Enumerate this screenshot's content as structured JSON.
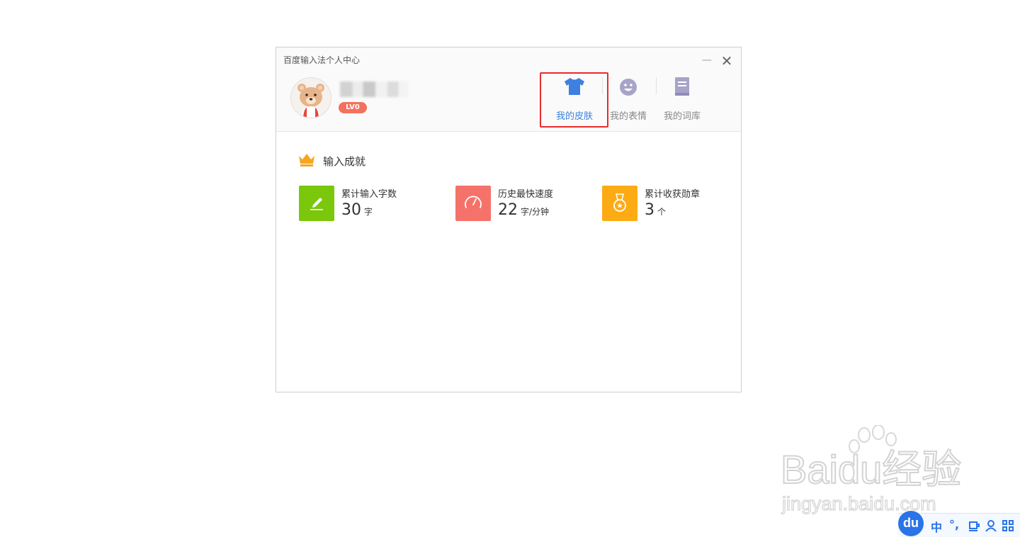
{
  "window": {
    "title": "百度输入法个人中心",
    "minimize_glyph": "—",
    "close_glyph": "✕"
  },
  "profile": {
    "level": "LV0"
  },
  "nav": [
    {
      "label": "我的皮肤",
      "icon": "tshirt-icon",
      "active": true
    },
    {
      "label": "我的表情",
      "icon": "smiley-icon",
      "active": false
    },
    {
      "label": "我的词库",
      "icon": "book-icon",
      "active": false
    }
  ],
  "achievements": {
    "title": "输入成就",
    "stats": [
      {
        "name": "累计输入字数",
        "value": "30",
        "unit": "字",
        "color": "#7ac70c",
        "icon": "pencil-icon"
      },
      {
        "name": "历史最快速度",
        "value": "22",
        "unit": "字/分钟",
        "color": "#f5726a",
        "icon": "speedometer-icon"
      },
      {
        "name": "累计收获勋章",
        "value": "3",
        "unit": "个",
        "color": "#fdab15",
        "icon": "medal-icon"
      }
    ]
  },
  "watermark": {
    "brand": "Baidu经验",
    "url": "jingyan.baidu.com"
  },
  "ime": {
    "logo": "du",
    "lang": "中",
    "punct": "°,"
  },
  "colors": {
    "accent": "#3d80e0",
    "highlight": "#e82c2c",
    "level_badge": "#f3715e"
  }
}
